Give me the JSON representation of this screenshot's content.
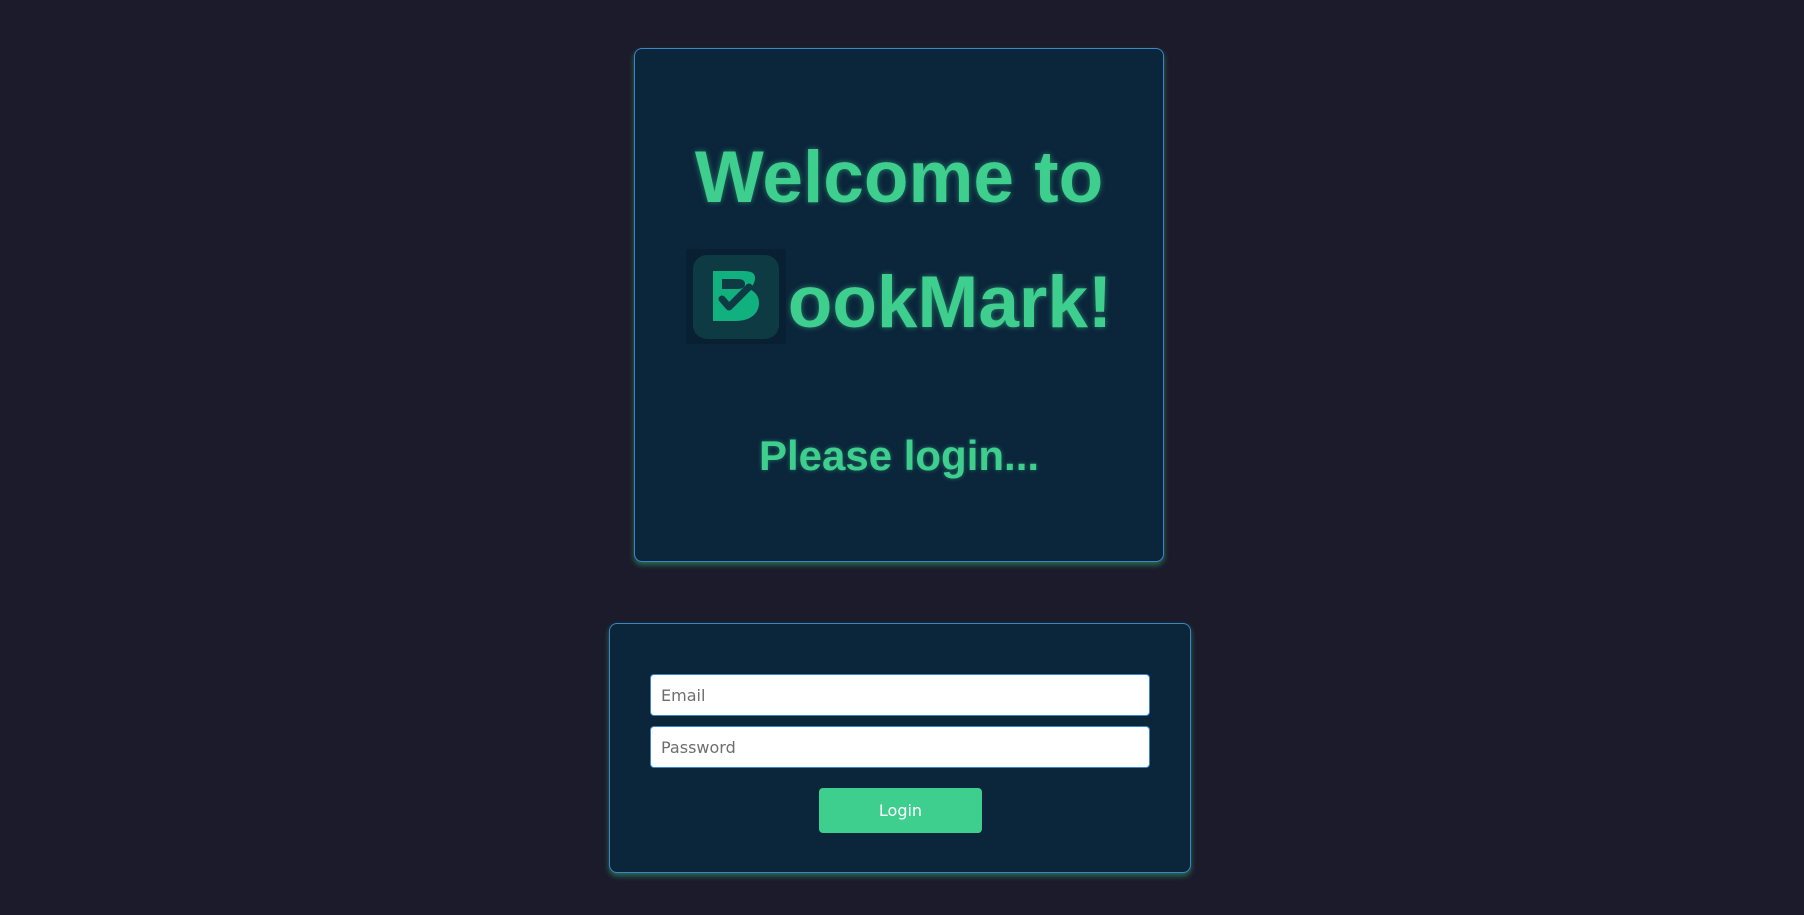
{
  "welcome": {
    "line1": "Welcome to",
    "brand_rest": "ookMark!",
    "subtitle": "Please login...",
    "logo_icon": "bookmark-b-check-logo-icon"
  },
  "login_form": {
    "email": {
      "placeholder": "Email",
      "value": ""
    },
    "password": {
      "placeholder": "Password",
      "value": ""
    },
    "submit_label": "Login"
  },
  "colors": {
    "background": "#1b1b2b",
    "card": "#0b253b",
    "card_border": "#3a86c8",
    "accent_green": "#3ecf8e",
    "logo_green": "#10b07f"
  }
}
